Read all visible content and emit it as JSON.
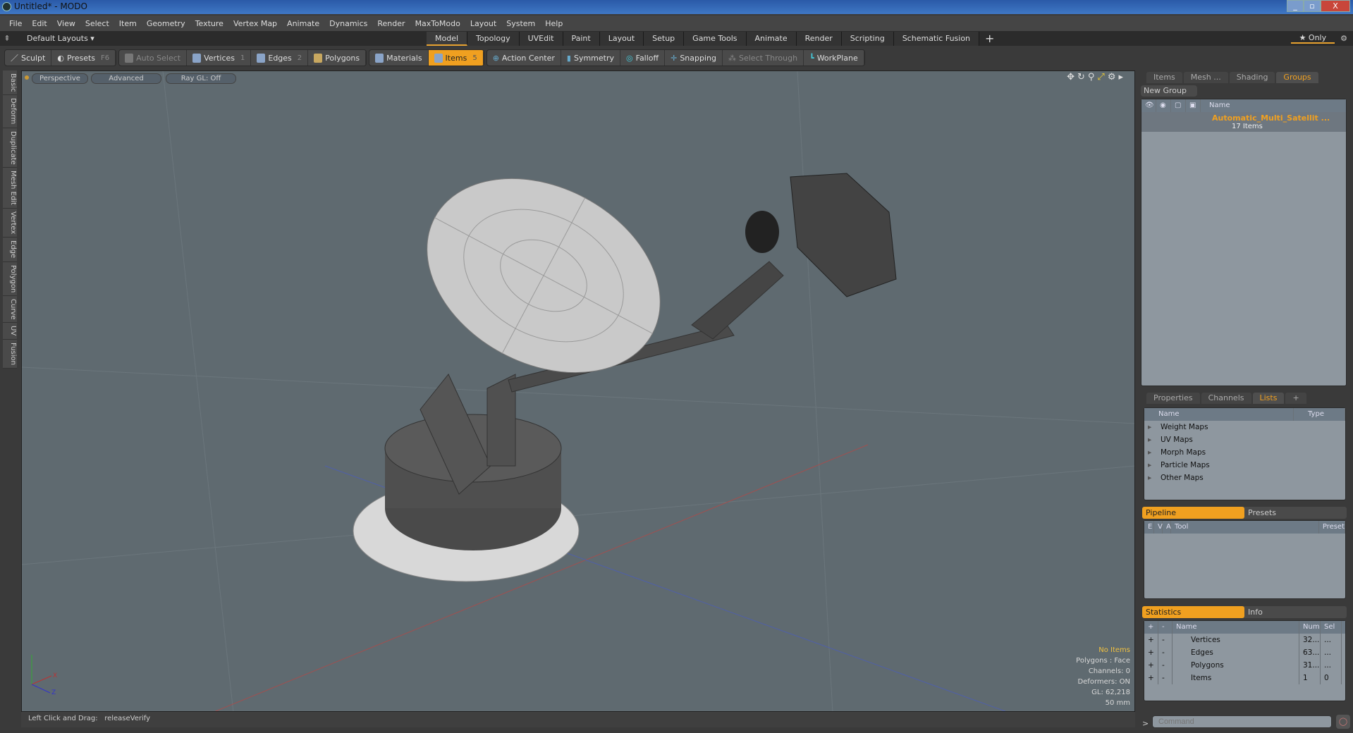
{
  "window": {
    "title": "Untitled* - MODO",
    "minimize": "_",
    "restore": "▫",
    "close": "X"
  },
  "menu": [
    "File",
    "Edit",
    "View",
    "Select",
    "Item",
    "Geometry",
    "Texture",
    "Vertex Map",
    "Animate",
    "Dynamics",
    "Render",
    "MaxToModo",
    "Layout",
    "System",
    "Help"
  ],
  "layouts": {
    "selector": "Default Layouts ▾",
    "tabs": [
      "Model",
      "Topology",
      "UVEdit",
      "Paint",
      "Layout",
      "Setup",
      "Game Tools",
      "Animate",
      "Render",
      "Scripting",
      "Schematic Fusion"
    ],
    "active": "Model",
    "add": "+",
    "only": "★ Only"
  },
  "toolbar": {
    "sculpt": "Sculpt",
    "presets": "Presets",
    "presets_key": "F6",
    "auto_select": "Auto Select",
    "vertices": "Vertices",
    "vertices_key": "1",
    "edges": "Edges",
    "edges_key": "2",
    "polygons": "Polygons",
    "materials": "Materials",
    "items": "Items",
    "items_key": "5",
    "action_center": "Action Center",
    "symmetry": "Symmetry",
    "falloff": "Falloff",
    "snapping": "Snapping",
    "select_through": "Select Through",
    "workplane": "WorkPlane"
  },
  "left_tabs": [
    "Basic",
    "Deform",
    "Duplicate",
    "Mesh Edit",
    "Vertex",
    "Edge",
    "Polygon",
    "Curve",
    "UV",
    "Fusion"
  ],
  "viewport": {
    "view": "Perspective",
    "shading": "Advanced",
    "raygl": "Ray GL: Off",
    "hud": {
      "selection": "No Items",
      "polygons": "Polygons : Face",
      "channels": "Channels: 0",
      "deformers": "Deformers: ON",
      "gl": "GL: 62,218",
      "scale": "50 mm"
    },
    "axis": {
      "x": "X",
      "y": "Y",
      "z": "Z"
    }
  },
  "status": {
    "hint": "Left Click and Drag:",
    "action": "releaseVerify"
  },
  "groups_panel": {
    "tabs": [
      "Items",
      "Mesh ...",
      "Shading",
      "Groups"
    ],
    "active": "Groups",
    "new_group": "New Group",
    "col_name": "Name",
    "group_name": "Automatic_Multi_Satellit ...",
    "group_count": "17 Items"
  },
  "lists_panel": {
    "tabs": [
      "Properties",
      "Channels",
      "Lists"
    ],
    "active": "Lists",
    "add": "+",
    "col_name": "Name",
    "col_type": "Type",
    "items": [
      "Weight Maps",
      "UV Maps",
      "Morph Maps",
      "Particle Maps",
      "Other Maps"
    ]
  },
  "pipeline": {
    "tabs": [
      "Pipeline",
      "Presets"
    ],
    "cols": [
      "E",
      "V",
      "A",
      "Tool",
      "Preset"
    ]
  },
  "statistics": {
    "tabs": [
      "Statistics",
      "Info"
    ],
    "cols": [
      "+",
      "-",
      "Name",
      "Num",
      "Sel"
    ],
    "rows": [
      {
        "name": "Vertices",
        "num": "32...",
        "sel": "..."
      },
      {
        "name": "Edges",
        "num": "63...",
        "sel": "..."
      },
      {
        "name": "Polygons",
        "num": "31...",
        "sel": "..."
      },
      {
        "name": "Items",
        "num": "1",
        "sel": "0"
      }
    ]
  },
  "command": {
    "placeholder": "Command",
    "prompt": ">"
  },
  "colors": {
    "accent": "#f0a020",
    "viewport": "#5f6a70",
    "panel": "#8e979f"
  }
}
